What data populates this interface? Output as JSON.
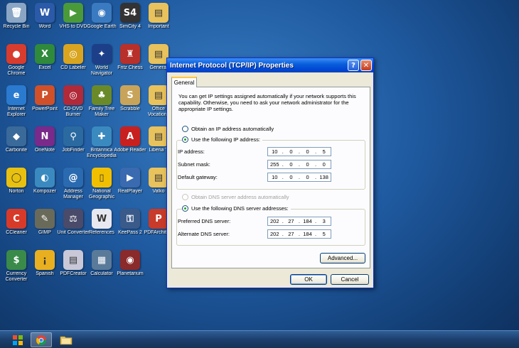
{
  "desktop": {
    "icons": [
      {
        "label": "Recycle Bin",
        "glyph": "🗑",
        "color": "#8aa6c4",
        "icon": "recycle-bin-icon"
      },
      {
        "label": "Word",
        "glyph": "W",
        "color": "#2b5aa8",
        "icon": "word-icon"
      },
      {
        "label": "VHS to DVD",
        "glyph": "▶",
        "color": "#4a9a3a",
        "icon": "vhs-to-dvd-icon"
      },
      {
        "label": "Google Earth",
        "glyph": "◉",
        "color": "#3a7ac0",
        "icon": "google-earth-icon"
      },
      {
        "label": "SimCity 4",
        "glyph": "S4",
        "color": "#333333",
        "icon": "simcity-icon"
      },
      {
        "label": "Important",
        "glyph": "▤",
        "color": "#e8c25c",
        "icon": "folder-icon"
      },
      {
        "label": "Google Chrome",
        "glyph": "●",
        "color": "#d83c2e",
        "icon": "chrome-icon"
      },
      {
        "label": "Excel",
        "glyph": "X",
        "color": "#2f8a3c",
        "icon": "excel-icon"
      },
      {
        "label": "CD Labeler",
        "glyph": "◎",
        "color": "#d9a520",
        "icon": "cd-labeler-icon"
      },
      {
        "label": "World Navigator",
        "glyph": "✦",
        "color": "#1d3f8a",
        "icon": "world-navigator-icon"
      },
      {
        "label": "Fritz Chess",
        "glyph": "♜",
        "color": "#b8302a",
        "icon": "chess-icon"
      },
      {
        "label": "General",
        "glyph": "▤",
        "color": "#e8c25c",
        "icon": "folder-icon"
      },
      {
        "label": "Internet Explorer",
        "glyph": "e",
        "color": "#2a7ad0",
        "icon": "internet-explorer-icon"
      },
      {
        "label": "PowerPoint",
        "glyph": "P",
        "color": "#d0502a",
        "icon": "powerpoint-icon"
      },
      {
        "label": "CD-DVD Burner",
        "glyph": "◎",
        "color": "#b02a3a",
        "icon": "cd-burner-icon"
      },
      {
        "label": "Family Tree Maker",
        "glyph": "♣",
        "color": "#6a8a2a",
        "icon": "family-tree-icon"
      },
      {
        "label": "Scrabble",
        "glyph": "S",
        "color": "#c8a45a",
        "icon": "scrabble-icon"
      },
      {
        "label": "Office Vocations",
        "glyph": "▤",
        "color": "#e8c25c",
        "icon": "folder-icon"
      },
      {
        "label": "Carbonite",
        "glyph": "◆",
        "color": "#3a6a9a",
        "icon": "carbonite-icon"
      },
      {
        "label": "OneNote",
        "glyph": "N",
        "color": "#7a2a8a",
        "icon": "onenote-icon"
      },
      {
        "label": "JobFinder",
        "glyph": "⚲",
        "color": "#2a6aa0",
        "icon": "jobfinder-icon"
      },
      {
        "label": "Britannica Encyclopedia",
        "glyph": "✚",
        "color": "#3a8ac0",
        "icon": "britannica-icon"
      },
      {
        "label": "Adobe Reader",
        "glyph": "A",
        "color": "#c8201e",
        "icon": "adobe-reader-icon"
      },
      {
        "label": "Liberia T",
        "glyph": "▤",
        "color": "#e8c25c",
        "icon": "folder-icon"
      },
      {
        "label": "Norton",
        "glyph": "◯",
        "color": "#e8c010",
        "icon": "norton-icon"
      },
      {
        "label": "Kompozer",
        "glyph": "◐",
        "color": "#3a8ac0",
        "icon": "kompozer-icon"
      },
      {
        "label": "Address Manager",
        "glyph": "@",
        "color": "#2a6ab0",
        "icon": "address-manager-icon"
      },
      {
        "label": "National Geographic",
        "glyph": "▯",
        "color": "#f0c000",
        "icon": "national-geographic-icon"
      },
      {
        "label": "RealPlayer",
        "glyph": "▶",
        "color": "#3a6ab0",
        "icon": "realplayer-icon"
      },
      {
        "label": "Valko",
        "glyph": "▤",
        "color": "#e8c25c",
        "icon": "folder-icon"
      },
      {
        "label": "CCleaner",
        "glyph": "C",
        "color": "#d83a2a",
        "icon": "ccleaner-icon"
      },
      {
        "label": "GIMP",
        "glyph": "✎",
        "color": "#6a6a5a",
        "icon": "gimp-icon"
      },
      {
        "label": "Unit Converter",
        "glyph": "⚖",
        "color": "#4a4a6a",
        "icon": "unit-converter-icon"
      },
      {
        "label": "References",
        "glyph": "W",
        "color": "#e8e8f0",
        "icon": "references-icon"
      },
      {
        "label": "KeePass 2",
        "glyph": "⚿",
        "color": "#3a5a8a",
        "icon": "keepass-icon"
      },
      {
        "label": "PDFArchitect",
        "glyph": "P",
        "color": "#c83a2a",
        "icon": "pdfarchitect-icon"
      },
      {
        "label": "Currency Converter",
        "glyph": "$",
        "color": "#3a8a4a",
        "icon": "currency-converter-icon"
      },
      {
        "label": "Spanish",
        "glyph": "¡",
        "color": "#e8b020",
        "icon": "spanish-icon"
      },
      {
        "label": "PDFCreator",
        "glyph": "▤",
        "color": "#c8c8d8",
        "icon": "pdfcreator-icon"
      },
      {
        "label": "Calculator",
        "glyph": "▦",
        "color": "#5a7a9a",
        "icon": "calculator-icon"
      },
      {
        "label": "Planetarium",
        "glyph": "◉",
        "color": "#8a2a2a",
        "icon": "planetarium-icon"
      }
    ]
  },
  "dialog": {
    "title": "Internet Protocol (TCP/IP) Properties",
    "help_glyph": "?",
    "close_glyph": "✕",
    "tab_general": "General",
    "description": "You can get IP settings assigned automatically if your network supports this capability. Otherwise, you need to ask your network administrator for the appropriate IP settings.",
    "radio_auto_ip": "Obtain an IP address automatically",
    "radio_manual_ip": "Use the following IP address:",
    "ip_label": "IP address:",
    "ip_value": [
      "10",
      "0",
      "0",
      "5"
    ],
    "subnet_label": "Subnet mask:",
    "subnet_value": [
      "255",
      "0",
      "0",
      "0"
    ],
    "gateway_label": "Default gateway:",
    "gateway_value": [
      "10",
      "0",
      "0",
      "138"
    ],
    "radio_auto_dns": "Obtain DNS server address automatically",
    "radio_manual_dns": "Use the following DNS server addresses:",
    "preferred_dns_label": "Preferred DNS server:",
    "preferred_dns_value": [
      "202",
      "27",
      "184",
      "3"
    ],
    "alternate_dns_label": "Alternate DNS server:",
    "alternate_dns_value": [
      "202",
      "27",
      "184",
      "5"
    ],
    "advanced_button": "Advanced...",
    "ok_button": "OK",
    "cancel_button": "Cancel"
  },
  "colors": {
    "titlebar": "#0a5fdc",
    "dialog_bg": "#ece9d8",
    "tab_highlight": "#ffc73c",
    "desktop": "#1f5aa0"
  }
}
